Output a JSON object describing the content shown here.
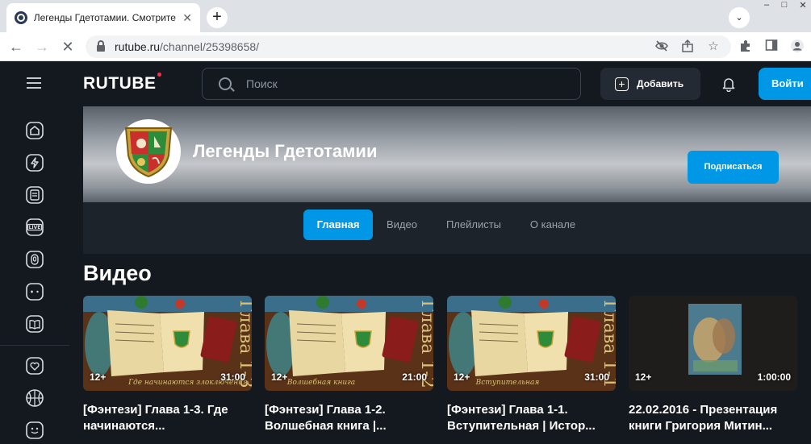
{
  "browser": {
    "tab_title": "Легенды Гдетотамии. Смотрите",
    "tab_close": "✕",
    "new_tab": "+",
    "tab_search": "⌄",
    "url_host": "rutube.ru",
    "url_path": "/channel/25398658/"
  },
  "header": {
    "logo": "RUTUBE",
    "search_placeholder": "Поиск",
    "add_label": "Добавить",
    "login_label": "Войти"
  },
  "channel": {
    "name": "Легенды Гдетотамии",
    "subscribe_label": "Подписаться",
    "tabs": [
      {
        "label": "Главная",
        "active": true
      },
      {
        "label": "Видео",
        "active": false
      },
      {
        "label": "Плейлисты",
        "active": false
      },
      {
        "label": "О канале",
        "active": false
      }
    ]
  },
  "videos_section": {
    "title": "Видео",
    "items": [
      {
        "age": "12+",
        "duration": "31:00",
        "title": "[Фэнтези] Глава 1-3. Где начинаются...",
        "chapter": "Глава 1-3",
        "caption": "Где начинаются злоключения"
      },
      {
        "age": "12+",
        "duration": "21:00",
        "title": "[Фэнтези] Глава 1-2. Волшебная книга |...",
        "chapter": "Глава 1-2",
        "caption": "Волшебная книга"
      },
      {
        "age": "12+",
        "duration": "31:00",
        "title": "[Фэнтези] Глава 1-1. Вступительная | Истор...",
        "chapter": "Глава 1-1",
        "caption": "Вступительная"
      },
      {
        "age": "12+",
        "duration": "1:00:00",
        "title": "22.02.2016 - Презентация книги Григория Митин..."
      }
    ]
  }
}
